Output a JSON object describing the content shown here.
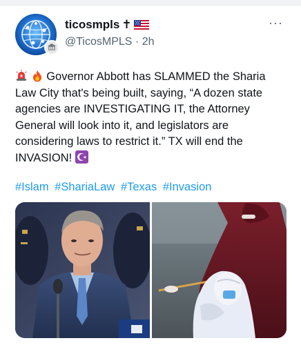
{
  "post": {
    "display_name": "ticosmpls",
    "name_suffix_cross": "✝",
    "handle": "@TicosMPLS",
    "separator": "·",
    "time": "2h",
    "more_label": "···",
    "text_main": "Governor Abbott has SLAMMED the Sharia Law City that's being built, saying, “A dozen state agencies are INVESTIGATING IT, the Attorney General will look into it, and legislators are considering laws to restrict it.” TX will end the INVASION!",
    "hashtags": [
      "#Islam",
      "#ShariaLaw",
      "#Texas",
      "#Invasion"
    ]
  },
  "icons": {
    "leading": [
      "police-light-icon",
      "fire-icon"
    ],
    "trailing": "star-and-crescent-icon",
    "flag": "us-flag-icon"
  },
  "colors": {
    "link": "#1d9bf0",
    "secondary_text": "#536471",
    "primary_text": "#0f1419"
  }
}
